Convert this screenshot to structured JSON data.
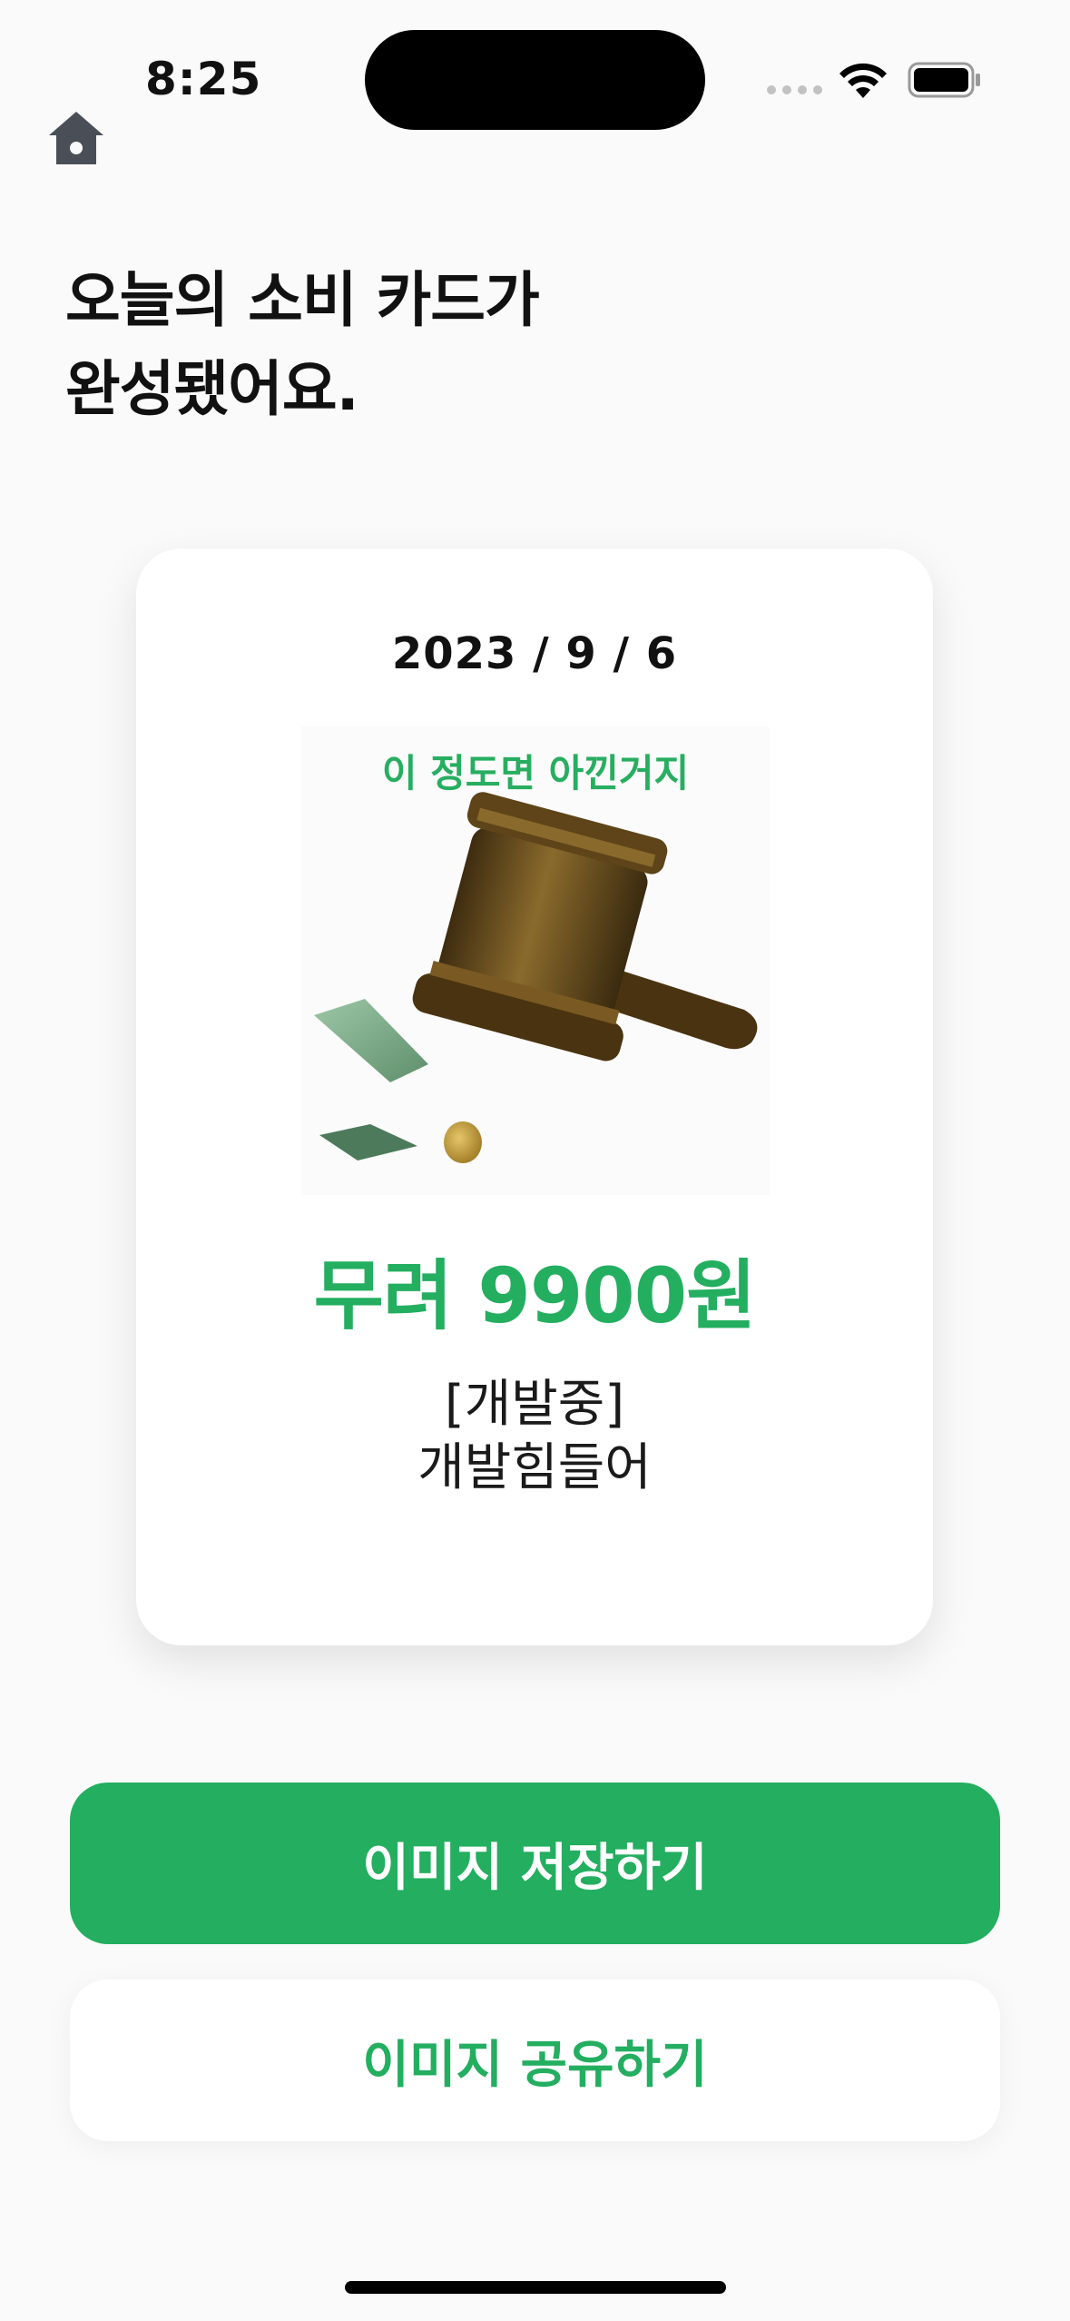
{
  "status_bar": {
    "time": "8:25"
  },
  "nav": {
    "home_icon": "home-icon"
  },
  "page": {
    "title": "오늘의 소비 카드가\n완성됐어요."
  },
  "card": {
    "date": "2023 / 9 / 6",
    "illustration_caption": "이 정도면 아낀거지",
    "amount": "무려 9900원",
    "memo": "[개발중]\n개발힘들어"
  },
  "actions": {
    "save_label": "이미지 저장하기",
    "share_label": "이미지 공유하기"
  },
  "colors": {
    "accent": "#23ae60",
    "background": "#fafafa",
    "card": "#ffffff"
  }
}
